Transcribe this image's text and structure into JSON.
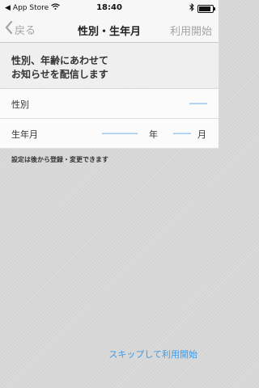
{
  "status": {
    "carrier": "App Store",
    "time": "18:40"
  },
  "nav": {
    "back_label": "戻る",
    "title": "性別・生年月",
    "start_label": "利用開始"
  },
  "heading": {
    "line1": "性別、年齢にあわせて",
    "line2": "お知らせを配信します"
  },
  "gender": {
    "label": "性別",
    "value": "――"
  },
  "birth": {
    "label": "生年月",
    "year_value": "――――",
    "year_unit": "年",
    "month_value": "――",
    "month_unit": "月"
  },
  "note": "設定は後から登録・変更できます",
  "skip_label": "スキップして利用開始",
  "colors": {
    "accent": "#3f9ae8",
    "muted": "#a5a5a5"
  }
}
